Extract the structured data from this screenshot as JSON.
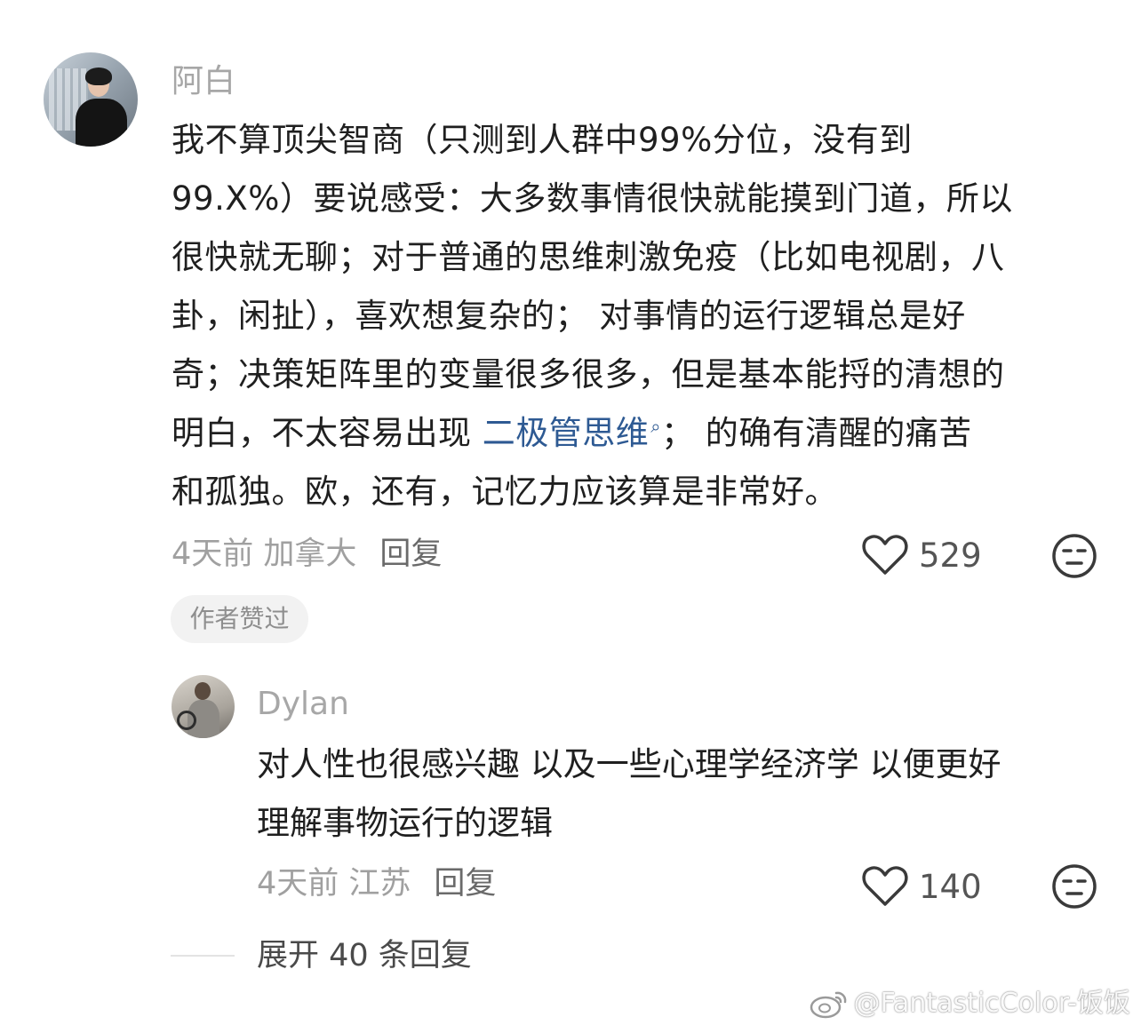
{
  "comment": {
    "username": "阿白",
    "lines": [
      [
        "我不算顶尖智商（只测到人群中99%分位，没有到"
      ],
      [
        " 99.X%）要说感受：大多数事情很快就能摸到门道，所以"
      ],
      [
        "很快就无聊；对于普通的思维刺激免疫（比如电视剧，八"
      ],
      [
        "卦，闲扯），喜欢想复杂的； 对事情的运行逻辑总是好"
      ],
      [
        "奇；决策矩阵里的变量很多很多，但是基本能捋的清想的"
      ]
    ],
    "line6_prefix": "明白，不太容易出现 ",
    "line6_link": "二极管思维",
    "line6_suffix": "； 的确有清醒的痛苦",
    "line7": "和孤独。欧，还有，记忆力应该算是非常好。",
    "time_location": "4天前 加拿大",
    "reply_label": "回复",
    "likes": "529",
    "author_liked": "作者赞过"
  },
  "reply": {
    "username": "Dylan",
    "line1": "对人性也很感兴趣 以及一些心理学经济学 以便更好",
    "line2": "理解事物运行的逻辑",
    "time_location": "4天前 江苏",
    "reply_label": "回复",
    "likes": "140"
  },
  "expand_label": "展开 40 条回复",
  "watermark": "@FantasticColor-饭饭",
  "icons": {
    "heart": "heart-icon",
    "meh": "meh-face-icon",
    "link": "search-link-icon",
    "weibo": "weibo-logo-icon"
  }
}
